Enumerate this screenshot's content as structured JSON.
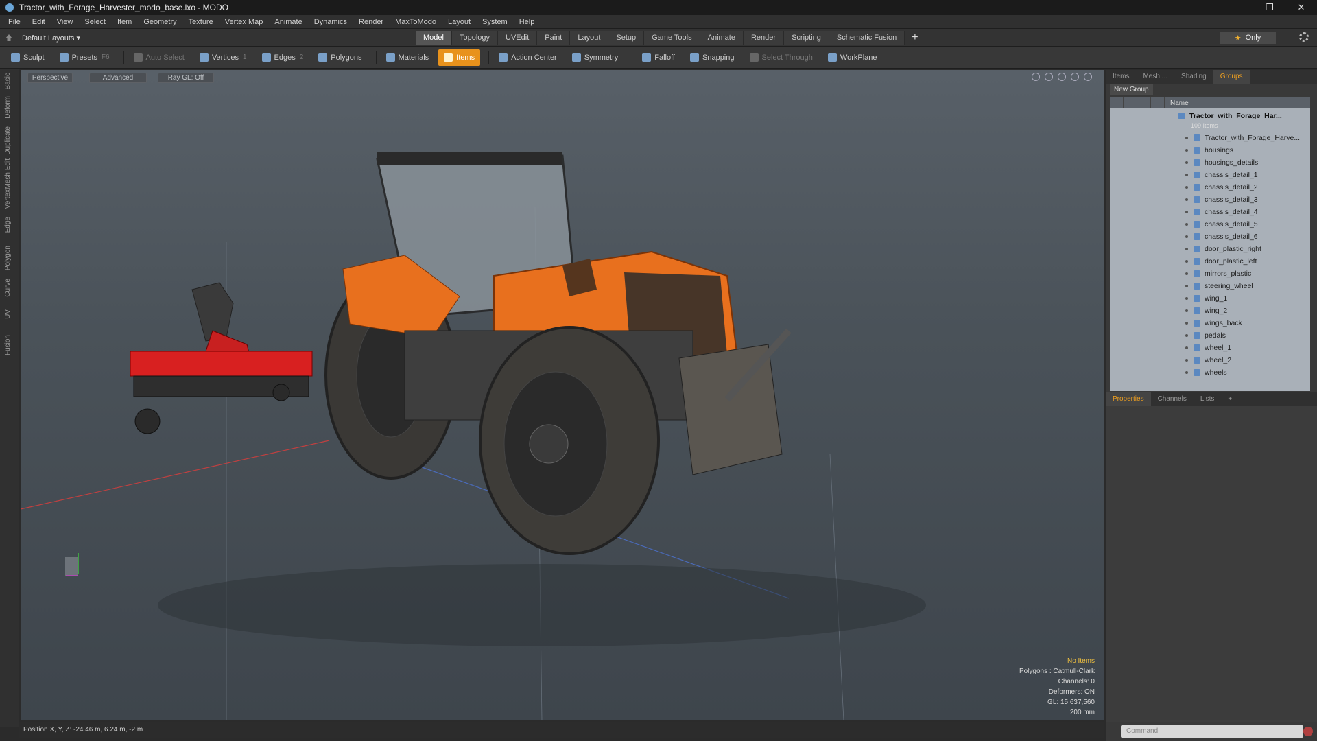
{
  "window": {
    "title": "Tractor_with_Forage_Harvester_modo_base.lxo - MODO",
    "controls": [
      "–",
      "❐",
      "✕"
    ]
  },
  "menu": [
    "File",
    "Edit",
    "View",
    "Select",
    "Item",
    "Geometry",
    "Texture",
    "Vertex Map",
    "Animate",
    "Dynamics",
    "Render",
    "MaxToModo",
    "Layout",
    "System",
    "Help"
  ],
  "layout": {
    "default_layouts": "Default Layouts ▾",
    "tabs": [
      "Model",
      "Topology",
      "UVEdit",
      "Paint",
      "Layout",
      "Setup",
      "Game Tools",
      "Animate",
      "Render",
      "Scripting",
      "Schematic Fusion"
    ],
    "active_tab": "Model",
    "plus": "+",
    "only": "Only"
  },
  "toolbar": [
    {
      "label": "Sculpt",
      "state": "normal"
    },
    {
      "label": "Presets",
      "kbd": "F6",
      "state": "normal"
    },
    {
      "label": "Auto Select",
      "state": "dim"
    },
    {
      "label": "Vertices",
      "kbd": "1",
      "state": "normal"
    },
    {
      "label": "Edges",
      "kbd": "2",
      "state": "normal"
    },
    {
      "label": "Polygons",
      "state": "normal"
    },
    {
      "label": "Materials",
      "state": "normal"
    },
    {
      "label": "Items",
      "state": "active"
    },
    {
      "label": "Action Center",
      "state": "normal"
    },
    {
      "label": "Symmetry",
      "state": "normal"
    },
    {
      "label": "Falloff",
      "state": "normal"
    },
    {
      "label": "Snapping",
      "state": "normal"
    },
    {
      "label": "Select Through",
      "state": "dim"
    },
    {
      "label": "WorkPlane",
      "state": "normal"
    }
  ],
  "left_strip": [
    "Basic",
    "Deform",
    "Duplicate",
    "Mesh Edit",
    "Vertex",
    "Edge",
    "Polygon",
    "Curve",
    "UV",
    "Fusion"
  ],
  "viewport": {
    "buttons": [
      "Perspective",
      "Advanced",
      "Ray GL: Off"
    ],
    "stats": {
      "selection": "No Items",
      "polygons": "Polygons : Catmull-Clark",
      "channels": "Channels: 0",
      "deformers": "Deformers: ON",
      "gl": "GL: 15,637,560",
      "scale": "200 mm"
    }
  },
  "status": "Position X, Y, Z:  -24.46 m, 6.24 m, -2 m",
  "right_panel": {
    "tabs": [
      "Items",
      "Mesh ...",
      "Shading",
      "Groups"
    ],
    "active_tab": "Groups",
    "new_group": "New Group",
    "name_col": "Name",
    "group_name": "Tractor_with_Forage_Har...",
    "group_count": "109 Items",
    "items": [
      "Tractor_with_Forage_Harve...",
      "housings",
      "housings_details",
      "chassis_detail_1",
      "chassis_detail_2",
      "chassis_detail_3",
      "chassis_detail_4",
      "chassis_detail_5",
      "chassis_detail_6",
      "door_plastic_right",
      "door_plastic_left",
      "mirrors_plastic",
      "steering_wheel",
      "wing_1",
      "wing_2",
      "wings_back",
      "pedals",
      "wheel_1",
      "wheel_2",
      "wheels"
    ],
    "props_tabs": [
      "Properties",
      "Channels",
      "Lists",
      "+"
    ],
    "props_active": "Properties",
    "command_placeholder": "Command"
  },
  "colors": {
    "accent": "#e8921c",
    "tractor_orange": "#e8701e",
    "harvester_red": "#d82020"
  }
}
